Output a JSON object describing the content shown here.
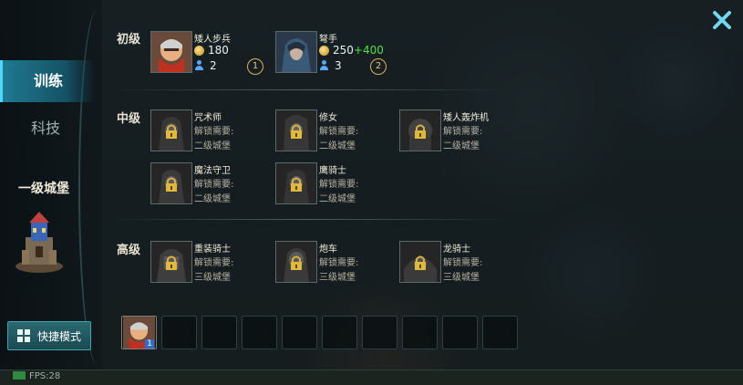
{
  "sidebar": {
    "tabs": [
      {
        "label": "训练",
        "active": true
      },
      {
        "label": "科技",
        "active": false
      }
    ],
    "castle_label": "一级城堡",
    "quick_mode_label": "快捷模式"
  },
  "footer": {
    "fps_text": "FPS:28"
  },
  "tiers": {
    "basic": {
      "label": "初级",
      "units": [
        {
          "name": "矮人步兵",
          "cost": "180",
          "bonus": "",
          "pop": "2",
          "level": "1",
          "icon": "dwarf-infantry-portrait"
        },
        {
          "name": "弩手",
          "cost": "250",
          "bonus": "+400",
          "pop": "3",
          "level": "2",
          "icon": "crossbowman-portrait"
        }
      ]
    },
    "mid": {
      "label": "中级",
      "units": [
        {
          "name": "咒术师",
          "req_label": "解锁需要:",
          "req": "二级城堡"
        },
        {
          "name": "修女",
          "req_label": "解锁需要:",
          "req": "二级城堡"
        },
        {
          "name": "矮人轰炸机",
          "req_label": "解锁需要:",
          "req": "二级城堡"
        },
        {
          "name": "魔法守卫",
          "req_label": "解锁需要:",
          "req": "二级城堡"
        },
        {
          "name": "鹰骑士",
          "req_label": "解锁需要:",
          "req": "二级城堡"
        }
      ]
    },
    "high": {
      "label": "高级",
      "units": [
        {
          "name": "重装骑士",
          "req_label": "解锁需要:",
          "req": "三级城堡"
        },
        {
          "name": "炮车",
          "req_label": "解锁需要:",
          "req": "三级城堡"
        },
        {
          "name": "龙骑士",
          "req_label": "解锁需要:",
          "req": "三级城堡"
        }
      ]
    }
  },
  "queue": {
    "filled": {
      "count": "1",
      "icon": "dwarf-infantry-portrait"
    },
    "empty_slots": 9
  },
  "colors": {
    "accent": "#1f7a90",
    "bonus": "#52e04a",
    "gold": "#d9b25a"
  }
}
